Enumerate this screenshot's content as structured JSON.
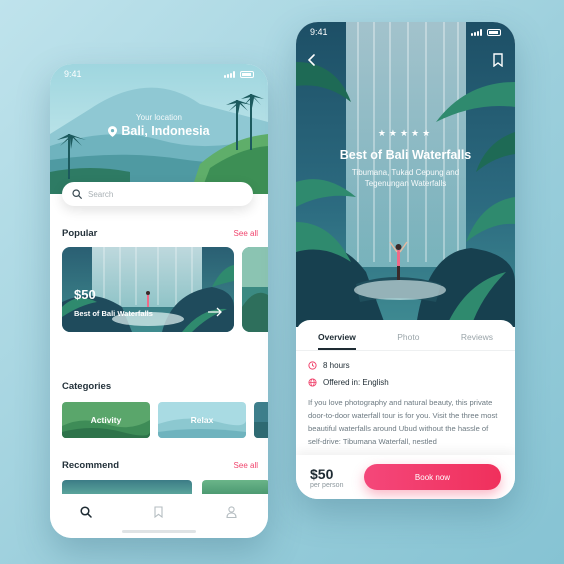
{
  "left_screen": {
    "status_time": "9:41",
    "location_label": "Your location",
    "location_value": "Bali, Indonesia",
    "search_placeholder": "Search",
    "popular": {
      "title": "Popular",
      "see_all": "See all",
      "card": {
        "price": "$50",
        "name": "Best of Bali Waterfalls"
      }
    },
    "categories": {
      "title": "Categories",
      "items": [
        {
          "label": "Activity"
        },
        {
          "label": "Relax"
        }
      ]
    },
    "recommend": {
      "title": "Recommend",
      "see_all": "See all"
    },
    "tabbar": {
      "icons": [
        "search-icon",
        "bookmark-icon",
        "profile-icon"
      ]
    }
  },
  "right_screen": {
    "status_time": "9:41",
    "rating_stars": "★★★★★",
    "title": "Best of Bali Waterfalls",
    "subtitle": "Tibumana, Tukad Cepung and Tegenungan Waterfalls",
    "tabs": [
      {
        "label": "Overview",
        "active": true
      },
      {
        "label": "Photo",
        "active": false
      },
      {
        "label": "Reviews",
        "active": false
      }
    ],
    "duration": "8 hours",
    "language": "Offered in: English",
    "description": "If you love photography and natural beauty, this private door-to-door waterfall tour is for you. Visit the three most beautiful waterfalls around Ubud without the hassle of self-drive: Tibumana Waterfall, nestled",
    "price": "$50",
    "price_unit": "per person",
    "book_label": "Book now"
  },
  "colors": {
    "accent": "#f0436c",
    "dark_text": "#1e2b33",
    "teal_dark": "#1c4f63",
    "teal_light": "#7fc6c8"
  }
}
